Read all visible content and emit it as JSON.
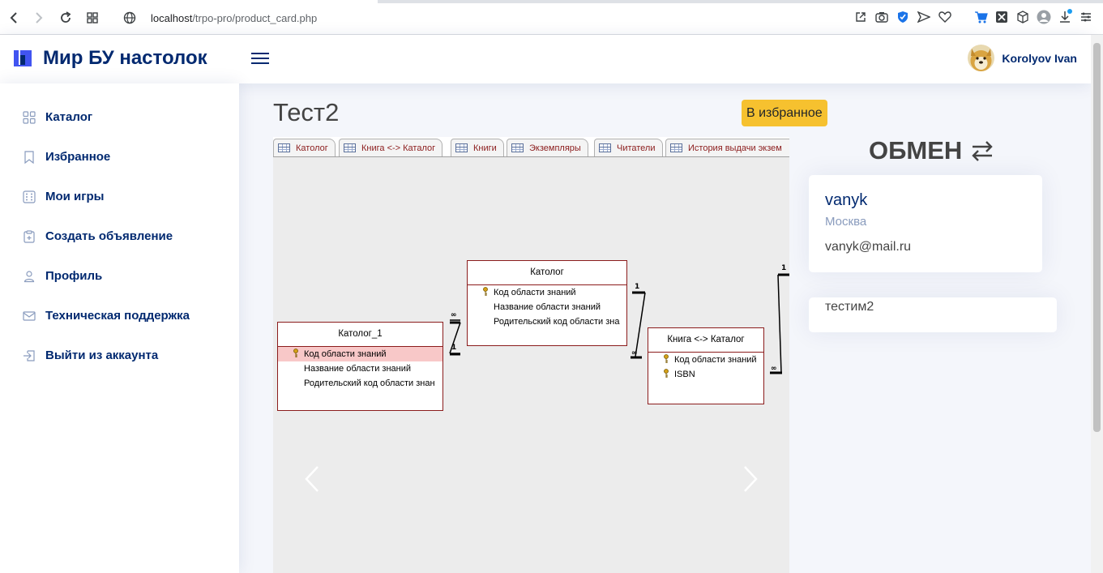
{
  "browser": {
    "url_host": "localhost",
    "url_path": "/trpo-pro/product_card.php"
  },
  "header": {
    "brand": "Мир БУ настолок",
    "user_name": "Korolyov Ivan"
  },
  "sidebar": {
    "items": [
      {
        "label": "Каталог",
        "icon": "grid-icon"
      },
      {
        "label": "Избранное",
        "icon": "bookmark-icon"
      },
      {
        "label": "Мои игры",
        "icon": "dice-icon"
      },
      {
        "label": "Создать объявление",
        "icon": "clipboard-plus-icon"
      },
      {
        "label": "Профиль",
        "icon": "person-icon"
      },
      {
        "label": "Техническая поддержка",
        "icon": "envelope-icon"
      },
      {
        "label": "Выйти из аккаунта",
        "icon": "box-arrow-in-right-icon"
      }
    ]
  },
  "product": {
    "title": "Тест2",
    "favorite_label": "В избранное"
  },
  "image": {
    "tabs": [
      "Католог",
      "Книга <-> Каталог",
      "Книги",
      "Экземпляры",
      "Читатели",
      "История выдачи экзем"
    ],
    "tables": [
      {
        "name": "Католог_1",
        "rows": [
          "Код области знаний",
          "Название области знаний",
          "Родительский код области знан"
        ]
      },
      {
        "name": "Католог",
        "rows": [
          "Код области знаний",
          "Название области знаний",
          "Родительский код области зна"
        ]
      },
      {
        "name": "Книга <-> Каталог",
        "rows": [
          "Код области знаний",
          "ISBN"
        ]
      }
    ],
    "relation_labels": {
      "one": "1",
      "many": "∞"
    }
  },
  "exchange": {
    "title": "ОБМЕН",
    "seller_name": "vanyk",
    "seller_city": "Москва",
    "seller_email": "vanyk@mail.ru",
    "description": "тестим2"
  },
  "colors": {
    "brand": "#012970",
    "favorite_button": "#f6c12f",
    "table_border": "#8b1c1c"
  }
}
